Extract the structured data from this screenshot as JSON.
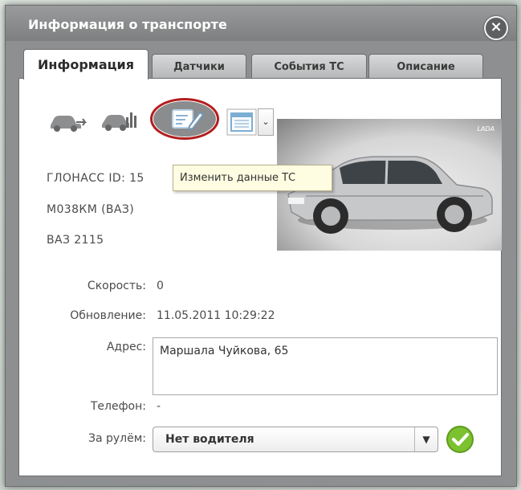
{
  "window": {
    "title": "Информация о транспорте",
    "close_icon": "close-icon"
  },
  "tabs": [
    {
      "label": "Информация",
      "active": true
    },
    {
      "label": "Датчики",
      "active": false
    },
    {
      "label": "События ТС",
      "active": false
    },
    {
      "label": "Описание",
      "active": false
    }
  ],
  "toolbar": {
    "icons": [
      "car-arrow-icon",
      "car-chart-icon",
      "edit-icon",
      "calendar-icon",
      "chevron-down-icon"
    ],
    "highlight_color": "#b31d1d",
    "dropdown_symbol": "⌄"
  },
  "tooltip": {
    "text": "Изменить данные ТС"
  },
  "vehicle": {
    "glonass_label": "ГЛОНАСС ID:",
    "glonass_value": "15",
    "plate": "М038КМ (ВАЗ)",
    "model": "ВАЗ 2115",
    "photo_brand": "LADA"
  },
  "details": {
    "speed_label": "Скорость:",
    "speed_value": "0",
    "update_label": "Обновление:",
    "update_value": "11.05.2011 10:29:22",
    "address_label": "Адрес:",
    "address_value": "Маршала Чуйкова, 65",
    "phone_label": "Телефон:",
    "phone_value": "-",
    "driver_label": "За рулём:",
    "driver_value": "Нет водителя",
    "driver_arrow": "▼"
  },
  "colors": {
    "titlebar": "#8a8b8c",
    "ok_button": "#78bf2a"
  }
}
